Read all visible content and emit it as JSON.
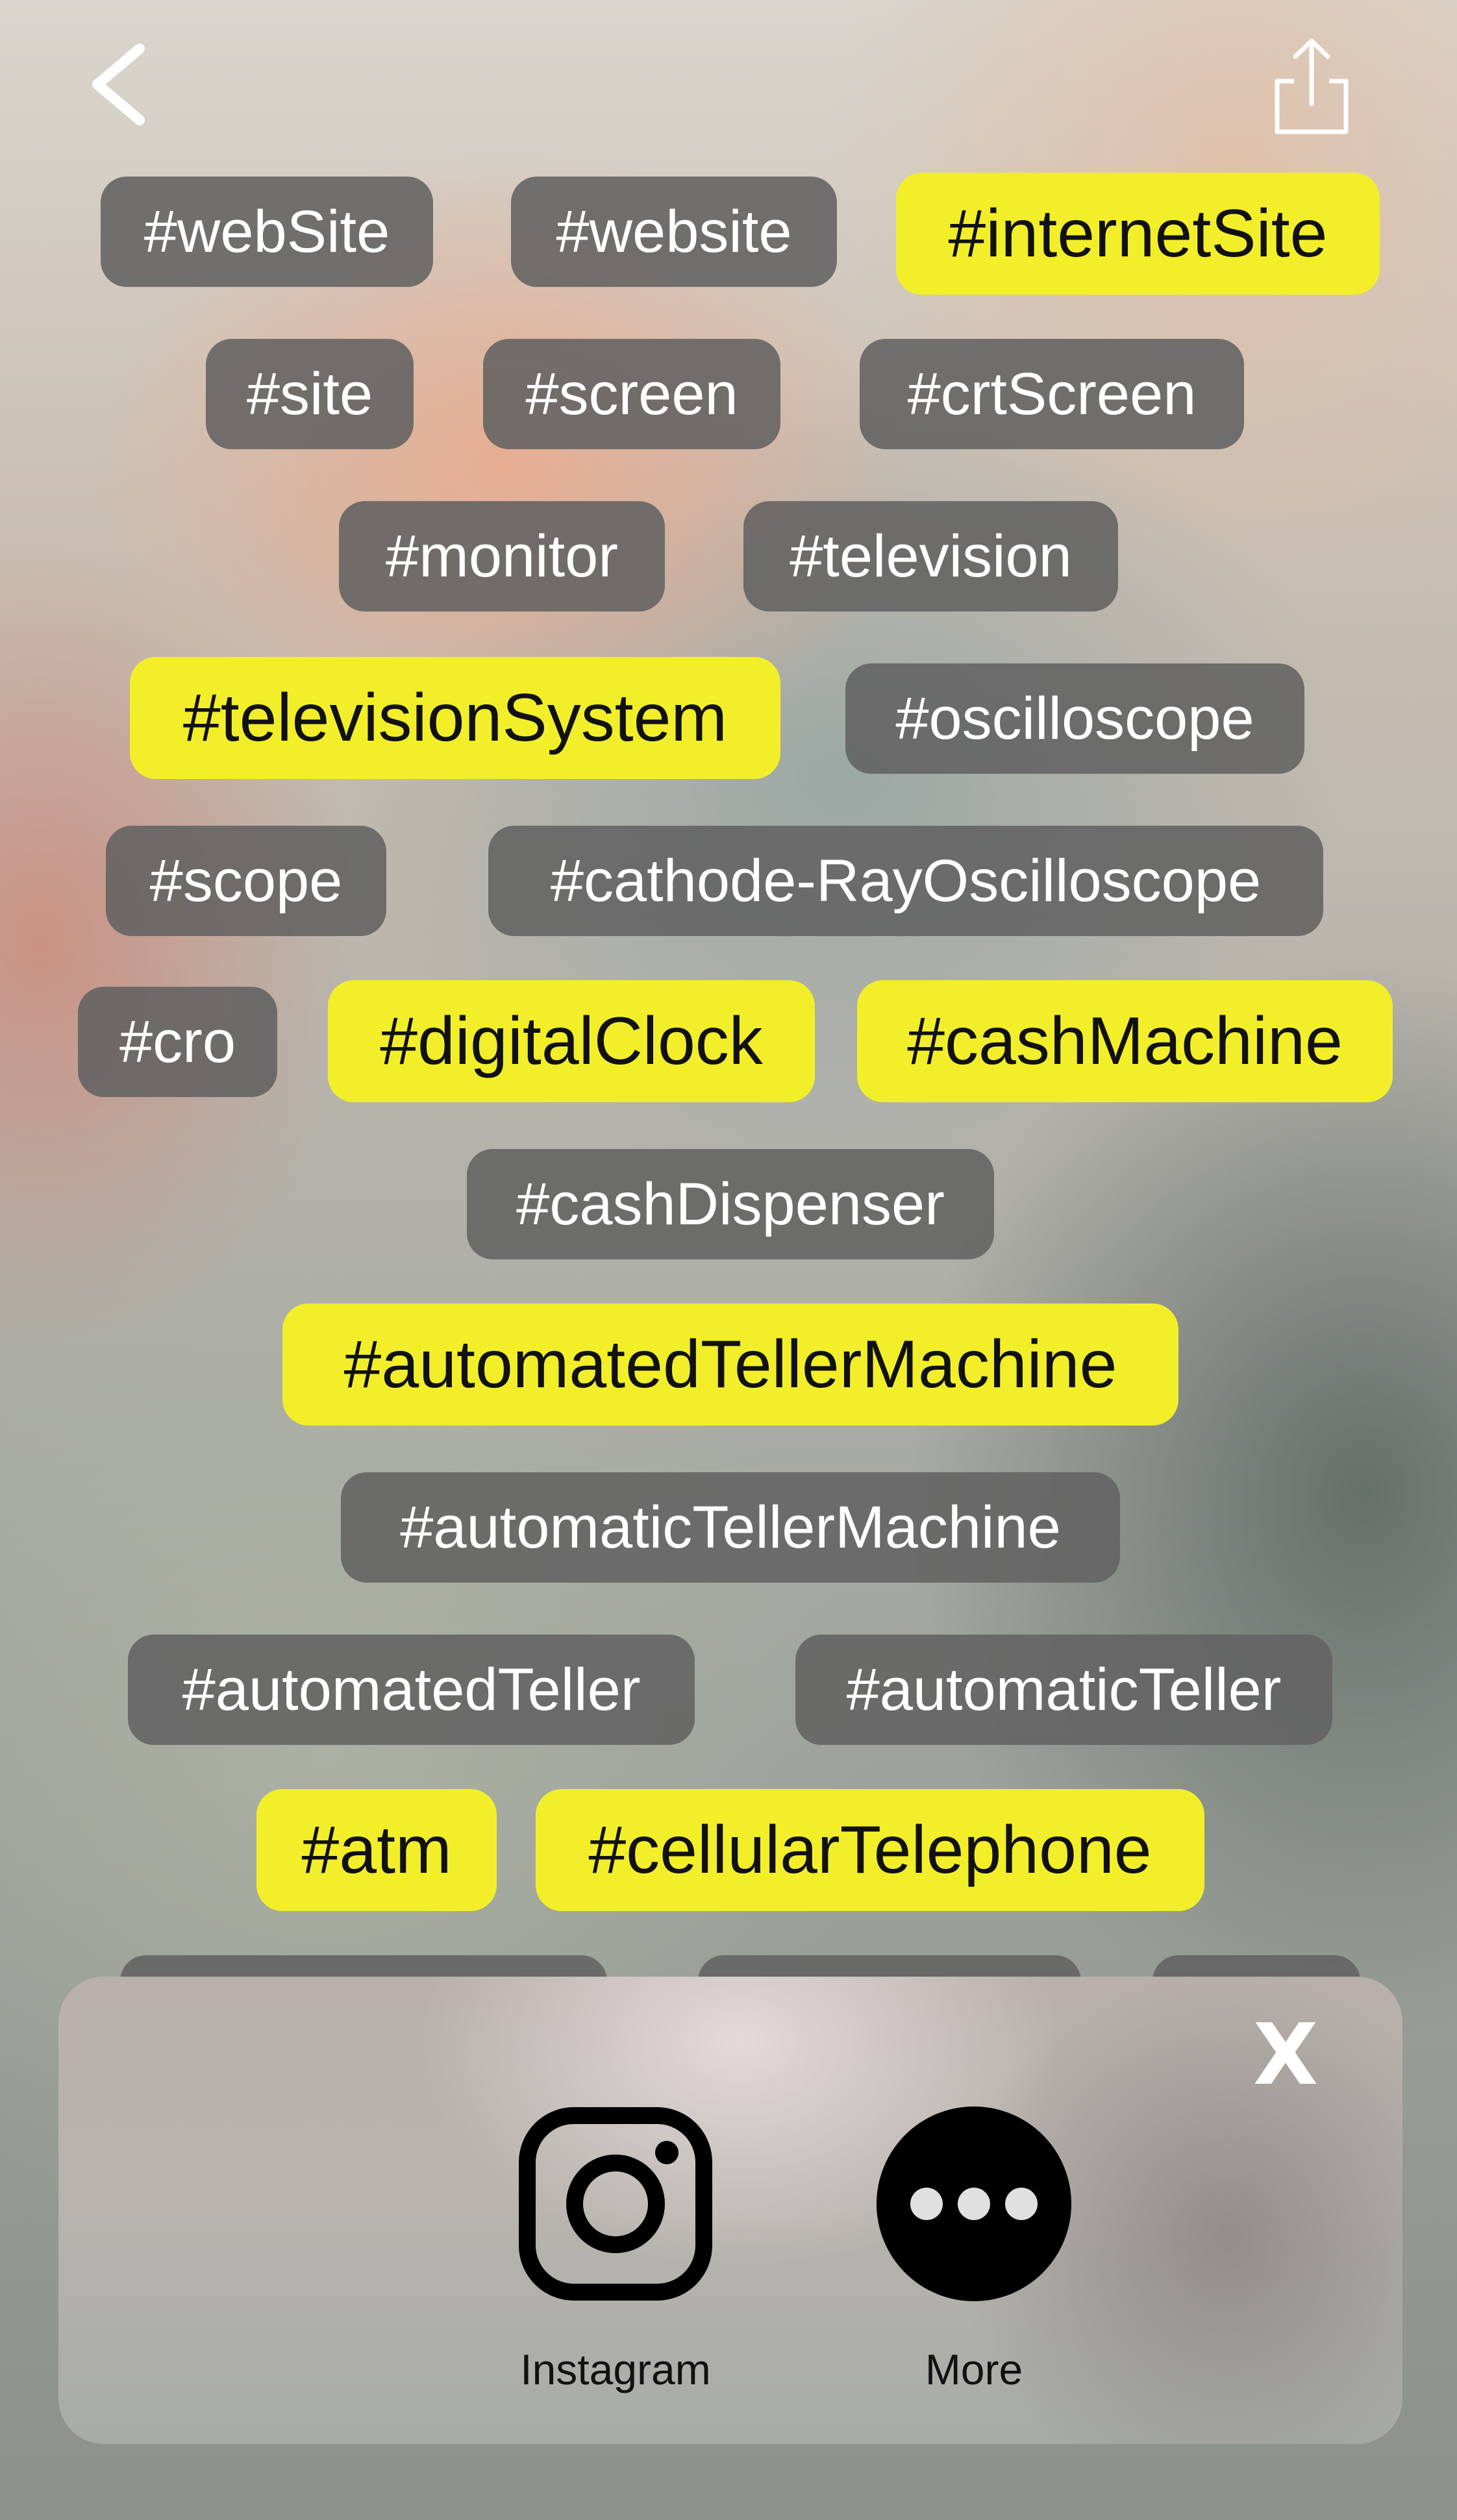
{
  "nav": {
    "back_icon": "chevron-left-icon",
    "share_icon": "share-icon"
  },
  "tags": [
    {
      "text": "#webSite",
      "highlighted": false
    },
    {
      "text": "#website",
      "highlighted": false
    },
    {
      "text": "#internetSite",
      "highlighted": true
    },
    {
      "text": "#site",
      "highlighted": false
    },
    {
      "text": "#screen",
      "highlighted": false
    },
    {
      "text": "#crtScreen",
      "highlighted": false
    },
    {
      "text": "#monitor",
      "highlighted": false
    },
    {
      "text": "#television",
      "highlighted": false
    },
    {
      "text": "#televisionSystem",
      "highlighted": true
    },
    {
      "text": "#oscilloscope",
      "highlighted": false
    },
    {
      "text": "#scope",
      "highlighted": false
    },
    {
      "text": "#cathode-RayOscilloscope",
      "highlighted": false
    },
    {
      "text": "#cro",
      "highlighted": false
    },
    {
      "text": "#digitalClock",
      "highlighted": true
    },
    {
      "text": "#cashMachine",
      "highlighted": true
    },
    {
      "text": "#cashDispenser",
      "highlighted": false
    },
    {
      "text": "#automatedTellerMachine",
      "highlighted": true
    },
    {
      "text": "#automaticTellerMachine",
      "highlighted": false
    },
    {
      "text": "#automatedTeller",
      "highlighted": false
    },
    {
      "text": "#automaticTeller",
      "highlighted": false
    },
    {
      "text": "#atm",
      "highlighted": true
    },
    {
      "text": "#cellularTelephone",
      "highlighted": true
    }
  ],
  "share_sheet": {
    "close_label": "X",
    "items": [
      {
        "label": "Instagram",
        "icon": "instagram-icon"
      },
      {
        "label": "More",
        "icon": "more-icon"
      }
    ]
  },
  "colors": {
    "tag_background": "#626262",
    "tag_text": "#ffffff",
    "highlight_background": "#f2ef2a",
    "highlight_text": "#111111"
  }
}
